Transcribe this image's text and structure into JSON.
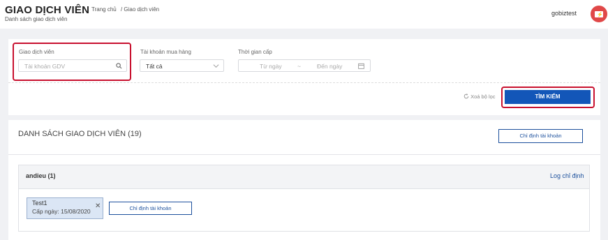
{
  "header": {
    "title": "GIAO DỊCH VIÊN",
    "subtitle": "Danh sách giao dịch viên",
    "breadcrumb": [
      "Trang chủ",
      "/ Giao dịch viên"
    ],
    "username": "gobiztest"
  },
  "filters": {
    "gdv": {
      "label": "Giao dịch viên",
      "placeholder": "Tài khoản GDV"
    },
    "account": {
      "label": "Tài khoản mua hàng",
      "value": "Tất cả"
    },
    "time": {
      "label": "Thời gian cấp",
      "from_placeholder": "Từ ngày",
      "separator": "~",
      "to_placeholder": "Đến ngày"
    },
    "reset_label": "Xoá bộ lọc",
    "search_label": "TÌM KIẾM"
  },
  "list": {
    "title": "DANH SÁCH GIAO DỊCH VIÊN (19)",
    "assign_label": "Chỉ định tài khoản",
    "groups": [
      {
        "name": "andieu (1)",
        "log_label": "Log chỉ định",
        "items": [
          {
            "name": "Test1",
            "date": "Cấp ngày: 15/08/2020"
          }
        ],
        "assign_label": "Chỉ định tài khoản"
      }
    ]
  },
  "colors": {
    "primary": "#1356b8",
    "highlight": "#c8102e",
    "avatar": "#e04848"
  }
}
